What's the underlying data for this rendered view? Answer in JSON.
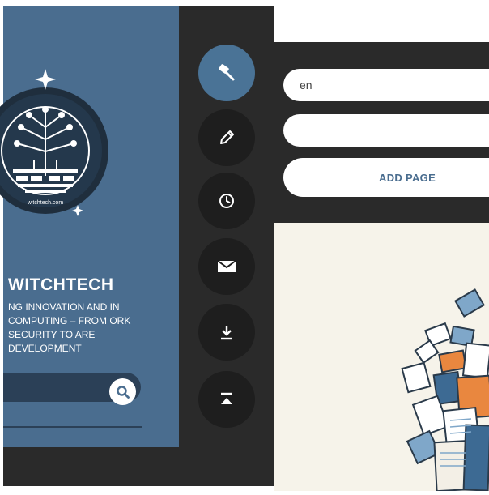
{
  "brand": {
    "name": "WITCHTECH",
    "tagline": "NG INNOVATION AND IN COMPUTING – FROM ORK SECURITY TO ARE DEVELOPMENT",
    "logo_ring_text": "witchtech.com"
  },
  "search": {
    "value": "",
    "placeholder": ""
  },
  "toolbar": {
    "items": [
      {
        "icon": "gavel-icon",
        "active": true
      },
      {
        "icon": "pencil-icon",
        "active": false
      },
      {
        "icon": "clock-icon",
        "active": false
      },
      {
        "icon": "envelope-icon",
        "active": false
      },
      {
        "icon": "download-icon",
        "active": false
      },
      {
        "icon": "scroll-top-icon",
        "active": false
      }
    ]
  },
  "form": {
    "language_value": "en",
    "title_value": "",
    "add_page_label": "ADD PAGE"
  },
  "colors": {
    "sidebar": "#4a6d8f",
    "dark": "#2a2a2a",
    "button": "#1e1e1e",
    "active": "#4a7396"
  }
}
